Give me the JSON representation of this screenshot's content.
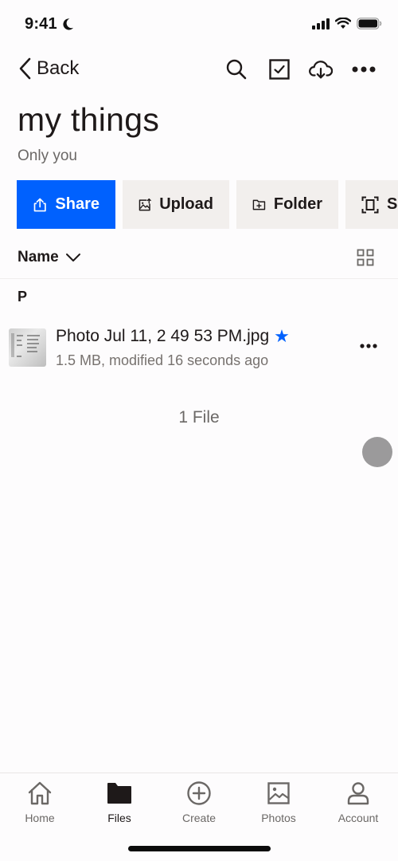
{
  "status_bar": {
    "time": "9:41",
    "icons": [
      "moon-icon",
      "signal-icon",
      "wifi-icon",
      "battery-icon"
    ]
  },
  "nav": {
    "back_label": "Back",
    "actions": [
      "search-icon",
      "select-checkbox-icon",
      "cloud-download-icon",
      "more-icon"
    ]
  },
  "header": {
    "title": "my things",
    "subtitle": "Only you"
  },
  "action_buttons": [
    {
      "label": "Share",
      "icon": "share-icon",
      "primary": true
    },
    {
      "label": "Upload",
      "icon": "upload-photo-icon"
    },
    {
      "label": "Folder",
      "icon": "new-folder-icon"
    },
    {
      "label": "Scan",
      "icon": "scan-icon"
    }
  ],
  "sort": {
    "label": "Name",
    "view_toggle": "grid-view-icon"
  },
  "sections": [
    {
      "letter": "P",
      "files": [
        {
          "name": "Photo Jul 11, 2 49 53 PM.jpg",
          "starred": true,
          "meta": "1.5 MB, modified 16 seconds ago"
        }
      ]
    }
  ],
  "file_count": "1 File",
  "tab_bar": {
    "tabs": [
      {
        "label": "Home",
        "icon": "home-icon",
        "active": false
      },
      {
        "label": "Files",
        "icon": "folder-icon",
        "active": true
      },
      {
        "label": "Create",
        "icon": "plus-circle-icon",
        "active": false
      },
      {
        "label": "Photos",
        "icon": "photos-icon",
        "active": false
      },
      {
        "label": "Account",
        "icon": "account-icon",
        "active": false
      }
    ]
  },
  "colors": {
    "accent": "#0061fe",
    "button_bg": "#f2efed",
    "text": "#1e1919",
    "muted": "#6b6866"
  }
}
